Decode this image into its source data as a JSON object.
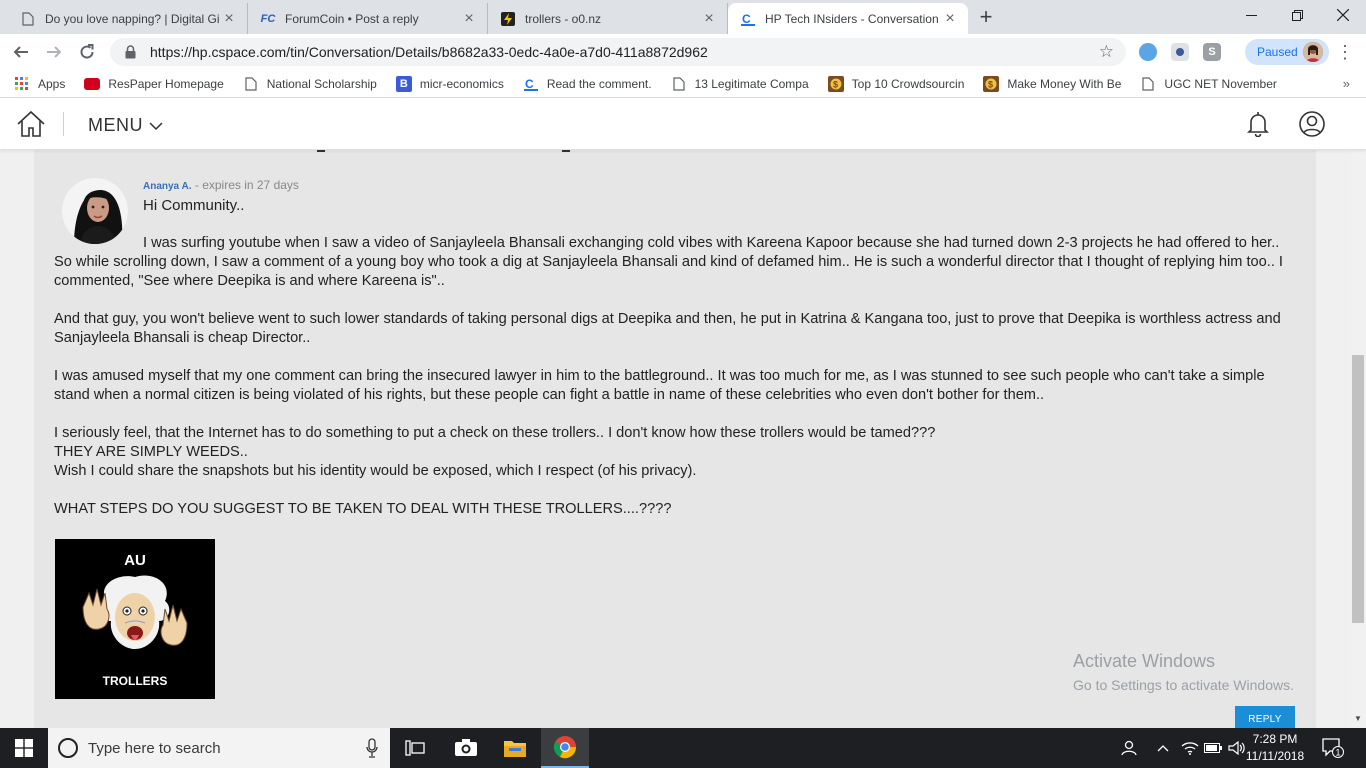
{
  "browser": {
    "tabs": [
      {
        "title": "Do you love napping? | Digital Gi",
        "icon": "page-icon"
      },
      {
        "title": "ForumCoin • Post a reply",
        "icon": "fc-icon"
      },
      {
        "title": "trollers - o0.nz",
        "icon": "bolt-icon"
      },
      {
        "title": "HP Tech INsiders - Conversation",
        "icon": "cspace-icon"
      }
    ],
    "url": "https://hp.cspace.com/tin/Conversation/Details/b8682a33-0edc-4a0e-a7d0-411a8872d962",
    "profile_status": "Paused",
    "bookmarks": [
      {
        "label": "Apps",
        "icon": "apps-grid-icon"
      },
      {
        "label": "ResPaper Homepage",
        "icon": "respaper-icon"
      },
      {
        "label": "National Scholarship",
        "icon": "page-icon"
      },
      {
        "label": "micr-economics",
        "icon": "b-icon"
      },
      {
        "label": "Read the comment.",
        "icon": "cspace-icon"
      },
      {
        "label": "13 Legitimate Compa",
        "icon": "page-icon"
      },
      {
        "label": "Top 10 Crowdsourcin",
        "icon": "money-icon"
      },
      {
        "label": "Make Money With Be",
        "icon": "money-icon"
      },
      {
        "label": "UGC NET November",
        "icon": "page-icon"
      }
    ]
  },
  "site": {
    "menu_label": "MENU"
  },
  "post": {
    "author": "Ananya A.",
    "meta_suffix": " - expires in 27 days",
    "greeting": "Hi Community..",
    "paragraph1": "I was surfing youtube when I saw a video of Sanjayleela Bhansali exchanging cold vibes with Kareena Kapoor because she had turned down 2-3 projects he had offered to her.. So while scrolling down, I saw a comment of a young boy who took a dig at Sanjayleela Bhansali and kind of defamed him.. He is such a wonderful director that I thought of replying him too.. I commented, \"See where Deepika is and where Kareena is\"..",
    "paragraph2": "And that guy, you won't believe went to such lower standards of taking personal digs at Deepika and then, he put in Katrina & Kangana too, just to prove that Deepika is worthless actress and Sanjayleela Bhansali is cheap Director..",
    "paragraph3": "I was amused myself that my one comment can bring the insecured lawyer in him to the battleground.. It was too much for me, as I was stunned to see such people who can't take a simple stand when a normal citizen is being violated of his rights, but these people can fight a battle in name of these celebrities who even don't bother for them..",
    "line4a": "I seriously feel, that the Internet has to do something to put a check on these trollers.. I don't know how these trollers would be tamed???",
    "line4b": "THEY ARE SIMPLY WEEDS..",
    "line4c": "Wish I could share the snapshots but his identity would be exposed, which I respect (of his privacy).",
    "question": "WHAT STEPS DO YOU SUGGEST TO BE TAKEN TO DEAL WITH THESE TROLLERS....????",
    "image_text_top": "AU",
    "image_text_bottom": "TROLLERS",
    "reply_label": "REPLY"
  },
  "watermark": {
    "line1": "Activate Windows",
    "line2": "Go to Settings to activate Windows."
  },
  "taskbar": {
    "search_placeholder": "Type here to search",
    "time": "7:28 PM",
    "date": "11/11/2018",
    "notification_count": "1"
  },
  "colors": {
    "accent": "#1a8fd8",
    "author_link": "#3b6fb6",
    "card_bg": "#e6e6e6",
    "taskbar_bg": "#1d1f22"
  }
}
